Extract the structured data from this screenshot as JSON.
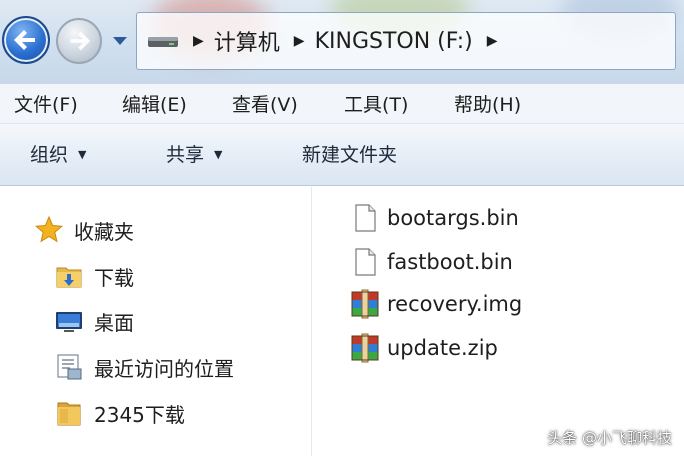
{
  "address_bar": {
    "drive_icon": "removable-drive-icon",
    "breadcrumbs": [
      "计算机",
      "KINGSTON (F:)"
    ]
  },
  "menu": {
    "items": [
      "文件(F)",
      "编辑(E)",
      "查看(V)",
      "工具(T)",
      "帮助(H)"
    ]
  },
  "commands": {
    "organize": "组织",
    "share": "共享",
    "new_folder": "新建文件夹"
  },
  "nav": {
    "favorites": {
      "label": "收藏夹",
      "icon": "star-icon"
    },
    "items": [
      {
        "label": "下载",
        "icon": "download-folder-icon"
      },
      {
        "label": "桌面",
        "icon": "desktop-icon"
      },
      {
        "label": "最近访问的位置",
        "icon": "recent-places-icon"
      },
      {
        "label": "2345下载",
        "icon": "folder-icon"
      }
    ]
  },
  "files": [
    {
      "name": "bootargs.bin",
      "icon": "file-icon"
    },
    {
      "name": "fastboot.bin",
      "icon": "file-icon"
    },
    {
      "name": "recovery.img",
      "icon": "archive-icon"
    },
    {
      "name": "update.zip",
      "icon": "archive-icon"
    }
  ],
  "watermark": "头条 @小飞聊科技",
  "colors": {
    "accent": "#2a6ed0",
    "command_bar": "#dbe6f3",
    "folder": "#e8b84a"
  }
}
